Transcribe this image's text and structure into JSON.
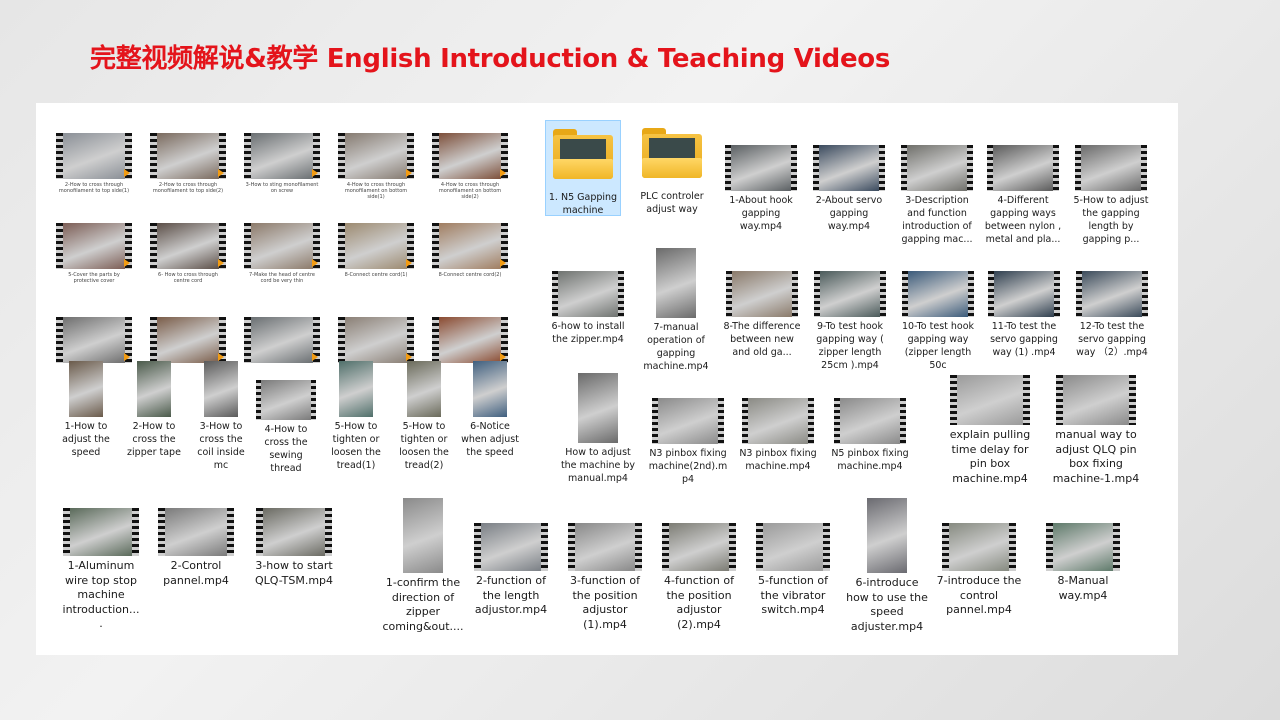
{
  "title": "完整视频解说&教学 English Introduction & Teaching Videos",
  "videos_small": [
    {
      "label": "2-How to cross through monofilament to top side(1)",
      "color": "#8a8f96"
    },
    {
      "label": "2-How to cross through monofilament to top side(2)",
      "color": "#7a6a5e"
    },
    {
      "label": "3-How to sting monofilament on screw",
      "color": "#6a6f72"
    },
    {
      "label": "4-How to cross through monofilament on bottom side(1)",
      "color": "#857a70"
    },
    {
      "label": "4-How to cross through monofilament on bottom side(2)",
      "color": "#7d4f3a"
    },
    {
      "label": "5-Cover the parts by protective cover",
      "color": "#7c5d55"
    },
    {
      "label": "6- How to cross through centre cord",
      "color": "#5b4e47"
    },
    {
      "label": "7-Make the head of centre cord be very thin",
      "color": "#8c7a6a"
    },
    {
      "label": "8-Connect centre cord(1)",
      "color": "#9c8a70"
    },
    {
      "label": "8-Connect centre cord(2)",
      "color": "#a07d60"
    },
    {
      "label": "",
      "color": "#6e6e6e"
    },
    {
      "label": "",
      "color": "#7a5c48"
    },
    {
      "label": "",
      "color": "#6a6f72"
    },
    {
      "label": "",
      "color": "#8a7f75"
    },
    {
      "label": "",
      "color": "#8a4a30"
    }
  ],
  "videos_portrait_row": [
    {
      "label": "1-How to adjust the speed",
      "color": "#6a5a4a"
    },
    {
      "label": "2-How to cross the zipper tape",
      "color": "#4a5a4a"
    },
    {
      "label": "3-How to cross the coil inside mc",
      "color": "#5a5a5a"
    },
    {
      "label": "4-How to cross the sewing thread",
      "color": "#7a7a7a"
    },
    {
      "label": "5-How to tighten or loosen the tread(1)",
      "color": "#4f6f6a"
    },
    {
      "label": "5-How to tighten or loosen the tread(2)",
      "color": "#6a6a5a"
    },
    {
      "label": "6-Notice when adjust the speed",
      "color": "#3f5f7f"
    }
  ],
  "videos_bottom_left": [
    {
      "label": "1-Aluminum wire top stop machine introduction....",
      "color": "#5a6a5a"
    },
    {
      "label": "2-Control pannel.mp4",
      "color": "#7a7a7a"
    },
    {
      "label": "3-how to start QLQ-TSM.mp4",
      "color": "#6a6a62"
    }
  ],
  "videos_bottom_row": [
    {
      "label": "1-confirm the direction of zipper coming&out....",
      "color": "#8a8a8a"
    },
    {
      "label": "2-function of the length adjustor.mp4",
      "color": "#7a7f85"
    },
    {
      "label": "3-function of the position adjustor (1).mp4",
      "color": "#888888"
    },
    {
      "label": "4-function of the position adjustor (2).mp4",
      "color": "#7c7c74"
    },
    {
      "label": "5-function of the vibrator switch.mp4",
      "color": "#9a9a9a"
    },
    {
      "label": "6-introduce how to use the speed adjuster.mp4",
      "color": "#6a6a70"
    },
    {
      "label": "7-introduce the control pannel.mp4",
      "color": "#868a80"
    },
    {
      "label": "8-Manual way.mp4",
      "color": "#5e7a6a"
    }
  ],
  "folders": [
    {
      "label": "1. N5 Gapping machine",
      "selected": true
    },
    {
      "label": "PLC controler adjust way",
      "selected": false
    }
  ],
  "videos_right_row1": [
    {
      "label": "1-About hook gapping way.mp4",
      "color": "#5a5f62"
    },
    {
      "label": "2-About servo gapping way.mp4",
      "color": "#3a4a5e"
    },
    {
      "label": "3-Description and function introduction of gapping mac...",
      "color": "#6f6f6a"
    },
    {
      "label": "4-Different gapping ways between nylon , metal and pla...",
      "color": "#5a5a5a"
    },
    {
      "label": "5-How to adjust the gapping length by gapping p...",
      "color": "#6a6a6a"
    }
  ],
  "videos_right_row2": [
    {
      "label": "6-how to install the zipper.mp4",
      "color": "#6f7370"
    },
    {
      "label": "7-manual operation of gapping machine.mp4",
      "color": "#6a6a6a"
    },
    {
      "label": "8-The difference between new and old ga...",
      "color": "#8a7a6a"
    },
    {
      "label": "9-To test hook gapping way ( zipper length 25cm ).mp4",
      "color": "#4a5a5a"
    },
    {
      "label": "10-To test hook gapping way (zipper length 50c",
      "color": "#3a5a7a"
    },
    {
      "label": "11-To test the servo gapping way (1) .mp4",
      "color": "#2f3f4f"
    },
    {
      "label": "12-To test the servo gapping way （2）.mp4",
      "color": "#3a4a5a"
    }
  ],
  "videos_right_row3": [
    {
      "label": "How to adjust the machine by manual.mp4",
      "color": "#6a6a6a"
    },
    {
      "label": "N3 pinbox fixing machine(2nd).mp4",
      "color": "#8a8a8a"
    },
    {
      "label": "N3 pinbox fixing machine.mp4",
      "color": "#8a8a84"
    },
    {
      "label": "N5 pinbox fixing machine.mp4",
      "color": "#8a8a8a"
    },
    {
      "label": "explain pulling time delay for pin box machine.mp4",
      "color": "#9a9a9a"
    },
    {
      "label": "manual way to adjust QLQ pin box fixing machine-1.mp4",
      "color": "#8a8a8a"
    }
  ]
}
